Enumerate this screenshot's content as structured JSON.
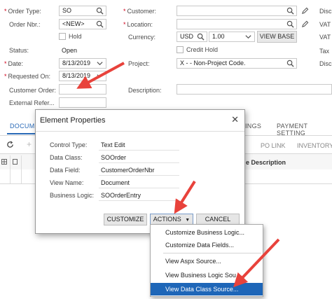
{
  "form": {
    "order_type_label": "Order Type:",
    "order_type_value": "SO",
    "order_nbr_label": "Order Nbr.:",
    "order_nbr_value": "<NEW>",
    "hold_label": "Hold",
    "status_label": "Status:",
    "status_value": "Open",
    "date_label": "Date:",
    "date_value": "8/13/2019",
    "requested_on_label": "Requested On:",
    "requested_on_value": "8/13/2019",
    "customer_order_label": "Customer Order:",
    "external_ref_label": "External Refer...",
    "customer_label": "Customer:",
    "location_label": "Location:",
    "currency_label": "Currency:",
    "currency_value": "USD",
    "rate_value": "1.00",
    "view_base_label": "VIEW BASE",
    "credit_hold_label": "Credit Hold",
    "project_label": "Project:",
    "project_value": "X          - - Non-Project Code.",
    "description_label": "Description:",
    "right_cut_1": "Disc",
    "right_cut_2": "VAT",
    "right_cut_3": "VAT",
    "right_cut_4": "Tax",
    "right_cut_5": "Disc"
  },
  "tabs": {
    "documents": "DOCUM",
    "settings_cut": "INGS",
    "payment_settings": "PAYMENT SETTING"
  },
  "grid": {
    "po_link": "PO LINK",
    "inventory_cut": "INVENTORY",
    "line_description_cut": "e Description"
  },
  "dialog": {
    "title": "Element Properties",
    "control_type_label": "Control Type:",
    "control_type_value": "Text Edit",
    "data_class_label": "Data Class:",
    "data_class_value": "SOOrder",
    "data_field_label": "Data Field:",
    "data_field_value": "CustomerOrderNbr",
    "view_name_label": "View Name:",
    "view_name_value": "Document",
    "business_logic_label": "Business Logic:",
    "business_logic_value": "SOOrderEntry",
    "customize_label": "CUSTOMIZE",
    "actions_label": "ACTIONS",
    "cancel_label": "CANCEL"
  },
  "menu": {
    "items": [
      "Customize Business Logic...",
      "Customize Data Fields...",
      "View Aspx Source...",
      "View Business Logic Sou",
      "View Data Class Source..."
    ],
    "selected_index": 4
  },
  "colors": {
    "accent": "#1e66b8",
    "arrow": "#e8423b",
    "required": "#d0021b"
  }
}
